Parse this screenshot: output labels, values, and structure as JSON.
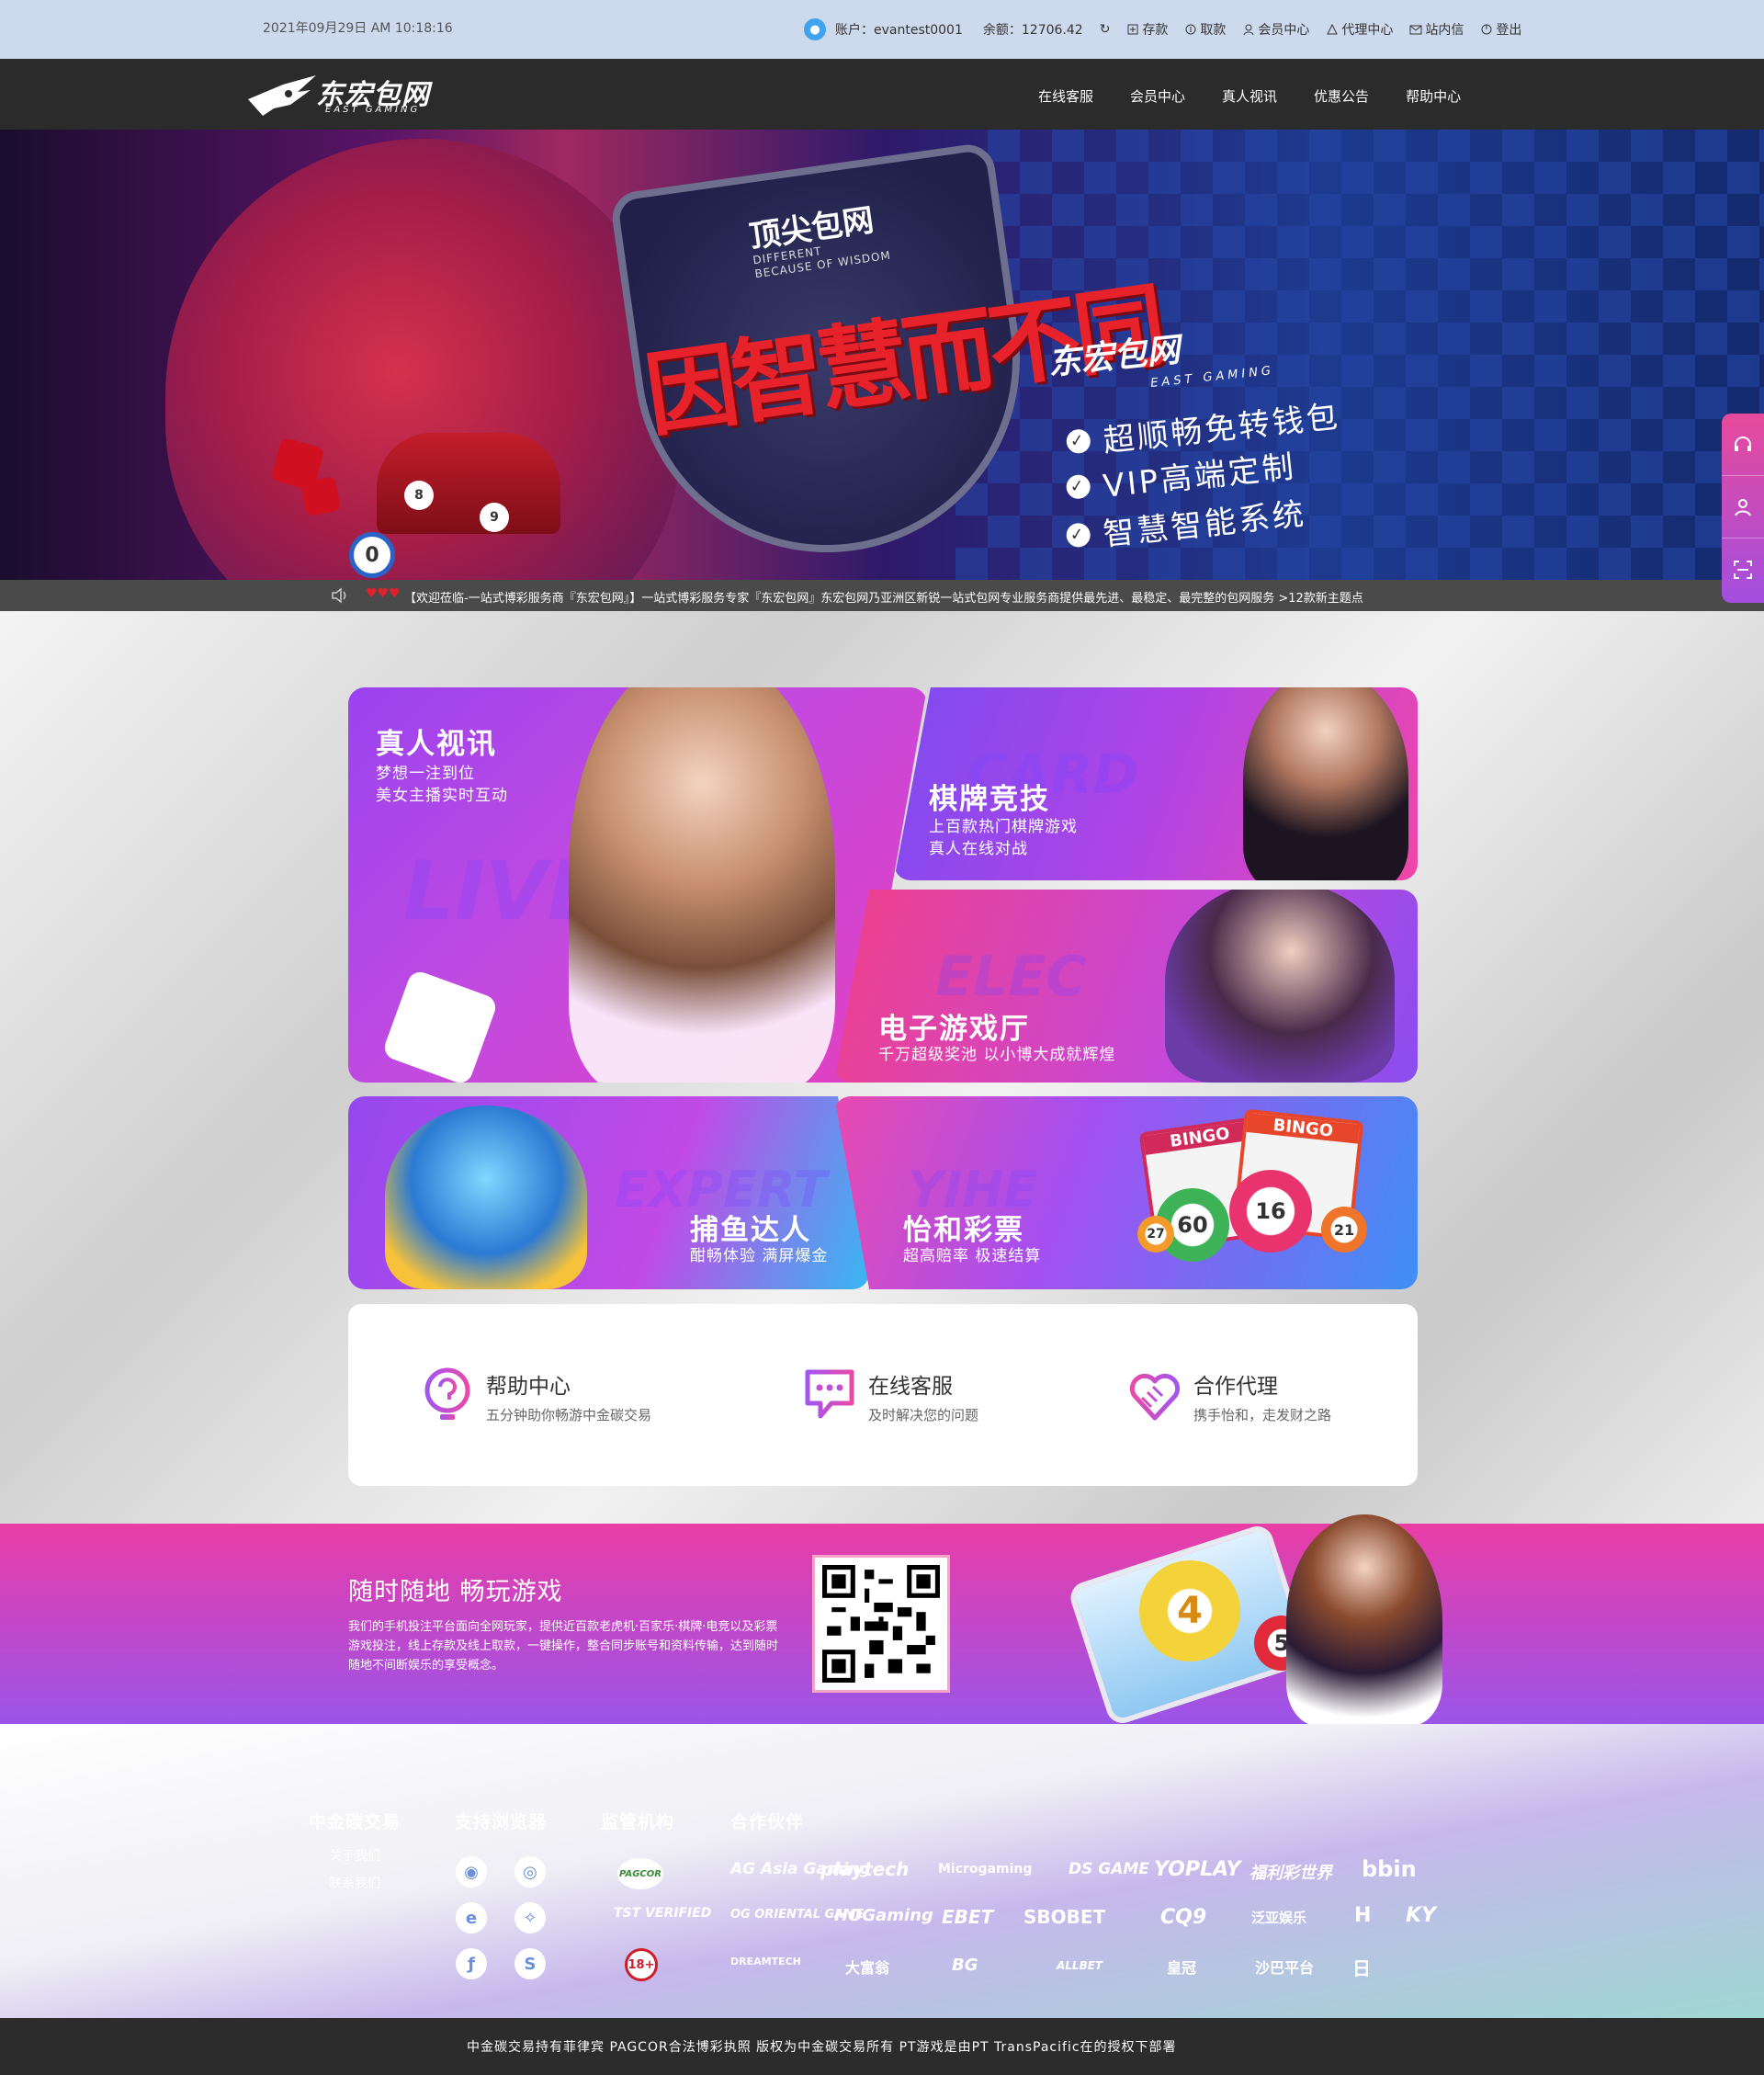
{
  "topbar": {
    "datetime": "2021年09月29日 AM 10:18:16",
    "account_label": "账户：evantest0001",
    "balance_label": "余额：12706.42",
    "links": [
      "存款",
      "取款",
      "会员中心",
      "代理中心",
      "站内信",
      "登出"
    ]
  },
  "nav": {
    "logo_text": "东宏包网",
    "logo_sub": "EAST GAMING",
    "links": [
      "在线客服",
      "会员中心",
      "真人视讯",
      "优惠公告",
      "帮助中心"
    ]
  },
  "banner": {
    "small": "顶尖包网",
    "en_line1": "DIFFERENT",
    "en_line2": "BECAUSE OF WISDOM",
    "title": "因智慧而不同",
    "logo_text": "东宏包网",
    "logo_sub": "EAST GAMING",
    "features": [
      "超顺畅免转钱包",
      "VIP高端定制",
      "智慧智能系统"
    ],
    "balls": [
      "8",
      "9",
      "0"
    ]
  },
  "marquee": {
    "hearts": "♥♥♥",
    "text": "【欢迎莅临-一站式博彩服务商『东宏包网』】一站式博彩服务专家『东宏包网』东宏包网乃亚洲区新锐一站式包网专业服务商提供最先进、最稳定、最完整的包网服务 >12款新主题点"
  },
  "games": [
    {
      "title": "真人视讯",
      "sub1": "梦想一注到位",
      "sub2": "美女主播实时互动",
      "watermark": "LIVE"
    },
    {
      "title": "棋牌竞技",
      "sub1": "上百款热门棋牌游戏",
      "sub2": "真人在线对战",
      "watermark": "CARD"
    },
    {
      "title": "电子游戏厅",
      "sub1": "千万超级奖池 以小博大成就辉煌",
      "sub2": "",
      "watermark": "ELEC"
    },
    {
      "title": "捕鱼达人",
      "sub1": "酣畅体验 满屏爆金",
      "sub2": "",
      "watermark": "EXPERT"
    },
    {
      "title": "怡和彩票",
      "sub1": "超高赔率 极速结算",
      "sub2": "",
      "watermark": "YIHE"
    }
  ],
  "lottery_balls": [
    "60",
    "16",
    "27",
    "21"
  ],
  "bingo_labels": [
    "BINGO",
    "BINGO"
  ],
  "services": [
    {
      "title": "帮助中心",
      "desc": "五分钟助你畅游中金碳交易"
    },
    {
      "title": "在线客服",
      "desc": "及时解决您的问题"
    },
    {
      "title": "合作代理",
      "desc": "携手怡和，走发财之路"
    }
  ],
  "mobile": {
    "title": "随时随地 畅玩游戏",
    "desc": "我们的手机投注平台面向全网玩家，提供近百款老虎机·百家乐·棋牌·电竞以及彩票游戏投注，线上存款及线上取款，一键操作，整合同步账号和资料传输，达到随时随地不间断娱乐的享受概念。",
    "balls": [
      "4",
      "5"
    ]
  },
  "footer": {
    "col1_title": "中金碳交易",
    "col1_links": [
      "关于我们",
      "联系我们"
    ],
    "col2_title": "支持浏览器",
    "col3_title": "监管机构",
    "col3_badges": [
      "PAGCOR",
      "TST VERIFIED",
      "18+"
    ],
    "col4_title": "合作伙伴",
    "partners": [
      "AG Asia Gaming",
      "playtech",
      "Microgaming",
      "DS GAME",
      "YOPLAY",
      "福利彩世界",
      "bbin",
      "OG ORIENTAL GAME",
      "HOGaming",
      "EBET",
      "SBOBET",
      "CQ9",
      "泛亚娱乐",
      "H",
      "KY",
      "DREAMTECH",
      "大富翁",
      "BG",
      "ALLBET",
      "皇冠",
      "沙巴平台",
      "日"
    ]
  },
  "copyright": "中金碳交易持有菲律宾 PAGCOR合法博彩执照 版权为中金碳交易所有 PT游戏是由PT TransPacific在的授权下部署",
  "colors": {
    "accent_pink": "#e74a9b",
    "accent_purple": "#a24ee0",
    "nav_bg": "#2b2b2b",
    "topbar_bg": "#cdd9ec"
  }
}
